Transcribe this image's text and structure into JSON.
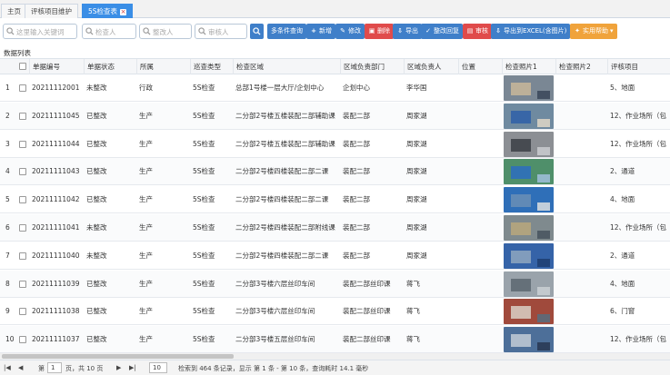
{
  "tabs": [
    {
      "label": "主页"
    },
    {
      "label": "评核项目维护"
    },
    {
      "label": "5S检查表",
      "active": true
    }
  ],
  "search": {
    "keyword_placeholder": "这里输入关键词",
    "inspector_placeholder": "检查人",
    "rectifier_placeholder": "整改人",
    "auditor_placeholder": "审核人"
  },
  "toolbar": {
    "multi_query": "多条件查询",
    "add": "新增",
    "edit": "修改",
    "delete": "删除",
    "export": "导出",
    "rectify_reply": "整改回复",
    "audit": "审核",
    "export_excel": "导出到EXCEL(含图片)",
    "help": "实用帮助"
  },
  "list_label": "数据列表",
  "columns": [
    "单据编号",
    "单据状态",
    "所属",
    "巡查类型",
    "检查区域",
    "区域负责部门",
    "区域负责人",
    "位置",
    "检查照片1",
    "检查照片2",
    "评核项目"
  ],
  "rows": [
    {
      "no": "1",
      "id": "20211112001",
      "status": "未整改",
      "belong": "行政",
      "type": "5S检查",
      "area": "总部1号楼一层大厅/企划中心",
      "dept": "企划中心",
      "owner": "李华国",
      "item": "5、地面",
      "photo": [
        "#7a8794",
        "#c9b79a",
        "#3d4a5c"
      ]
    },
    {
      "no": "2",
      "id": "20211111045",
      "status": "已整改",
      "belong": "生产",
      "type": "5S检查",
      "area": "二分部2号楼五楼装配二部辅助课",
      "dept": "装配二部",
      "owner": "周家湖",
      "item": "12、作业场所（包",
      "photo": [
        "#6f8aa0",
        "#2f5fa8",
        "#d8d2c4"
      ]
    },
    {
      "no": "3",
      "id": "20211111044",
      "status": "已整改",
      "belong": "生产",
      "type": "5S检查",
      "area": "二分部2号楼五楼装配二部辅助课",
      "dept": "装配二部",
      "owner": "周家湖",
      "item": "12、作业场所（包",
      "photo": [
        "#8c8f94",
        "#3b3f45",
        "#c7c9cc"
      ]
    },
    {
      "no": "4",
      "id": "20211111043",
      "status": "已整改",
      "belong": "生产",
      "type": "5S检查",
      "area": "二分部2号楼四楼装配二部二课",
      "dept": "装配二部",
      "owner": "周家湖",
      "item": "2、通道",
      "photo": [
        "#4f8f6a",
        "#2b6dbf",
        "#9bbcd6"
      ]
    },
    {
      "no": "5",
      "id": "20211111042",
      "status": "已整改",
      "belong": "生产",
      "type": "5S检查",
      "area": "二分部2号楼四楼装配二部二课",
      "dept": "装配二部",
      "owner": "周家湖",
      "item": "4、地面",
      "photo": [
        "#2f6fb8",
        "#6a8fb5",
        "#d3d8de"
      ]
    },
    {
      "no": "6",
      "id": "20211111041",
      "status": "未整改",
      "belong": "生产",
      "type": "5S检查",
      "area": "二分部2号楼四楼装配二部附线课",
      "dept": "装配二部",
      "owner": "周家湖",
      "item": "12、作业场所（包",
      "photo": [
        "#7f8a8e",
        "#b9a77c",
        "#4a5560"
      ]
    },
    {
      "no": "7",
      "id": "20211111040",
      "status": "未整改",
      "belong": "生产",
      "type": "5S检查",
      "area": "二分部2号楼四楼装配二部二课",
      "dept": "装配二部",
      "owner": "周家湖",
      "item": "2、通道",
      "photo": [
        "#3563a8",
        "#8ea6bf",
        "#1f3f73"
      ]
    },
    {
      "no": "8",
      "id": "20211111039",
      "status": "已整改",
      "belong": "生产",
      "type": "5S检查",
      "area": "二分部3号楼六层丝印车间",
      "dept": "装配二部丝印课",
      "owner": "蒋飞",
      "item": "4、地面",
      "photo": [
        "#9aa3ab",
        "#5c6770",
        "#c8cdd2"
      ]
    },
    {
      "no": "9",
      "id": "20211111038",
      "status": "已整改",
      "belong": "生产",
      "type": "5S检查",
      "area": "二分部3号楼六层丝印车间",
      "dept": "装配二部丝印课",
      "owner": "蒋飞",
      "item": "6、门窗",
      "photo": [
        "#a04a3c",
        "#d9d0c5",
        "#5b6b7a"
      ]
    },
    {
      "no": "10",
      "id": "20211111037",
      "status": "已整改",
      "belong": "生产",
      "type": "5S检查",
      "area": "二分部3号楼五层丝印车间",
      "dept": "装配二部丝印课",
      "owner": "蒋飞",
      "item": "12、作业场所（包",
      "photo": [
        "#4d6f99",
        "#c3ccd6",
        "#2a3a55"
      ]
    }
  ],
  "pager": {
    "page_label": "第",
    "page_value": "1",
    "page_total": "页，共 10 页",
    "page_size": "10",
    "summary": "检索到 464 条记录，显示 第 1 条 - 第 10 条，查询耗时 14.1 毫秒"
  }
}
